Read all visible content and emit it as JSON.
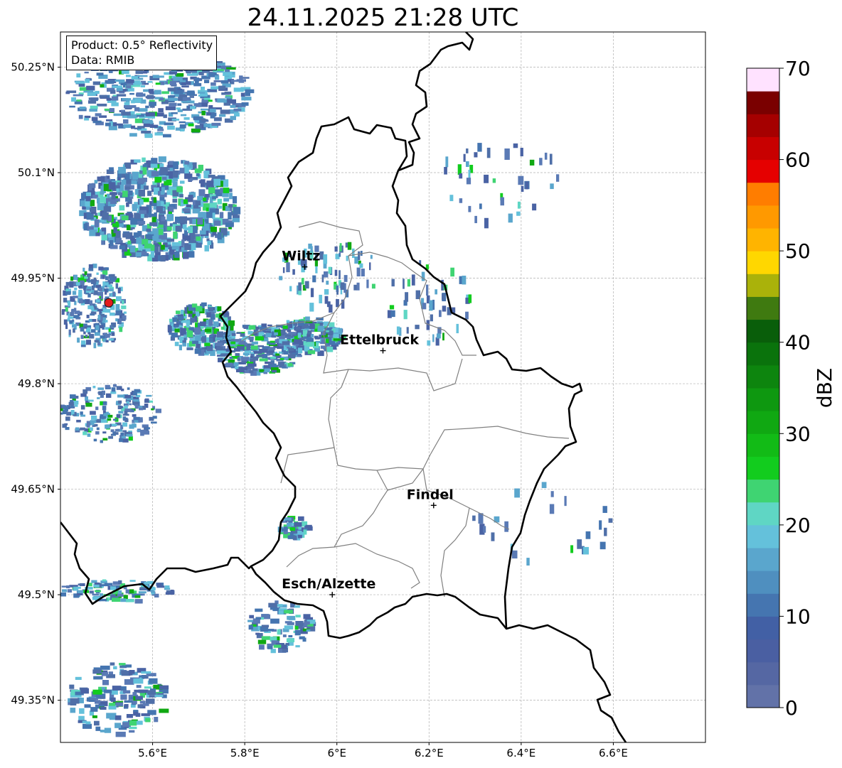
{
  "title": "24.11.2025 21:28 UTC",
  "info": {
    "product": "Product: 0.5° Reflectivity",
    "source": "Data: RMIB"
  },
  "map": {
    "extent": {
      "lon_min": 5.4,
      "lon_max": 6.8,
      "lat_min": 49.29,
      "lat_max": 50.3
    },
    "lon_ticks": [
      {
        "value": 5.6,
        "label": "5.6°E"
      },
      {
        "value": 5.8,
        "label": "5.8°E"
      },
      {
        "value": 6.0,
        "label": "6°E"
      },
      {
        "value": 6.2,
        "label": "6.2°E"
      },
      {
        "value": 6.4,
        "label": "6.4°E"
      },
      {
        "value": 6.6,
        "label": "6.6°E"
      }
    ],
    "lat_ticks": [
      {
        "value": 50.25,
        "label": "50.25°N"
      },
      {
        "value": 50.1,
        "label": "50.1°N"
      },
      {
        "value": 49.95,
        "label": "49.95°N"
      },
      {
        "value": 49.8,
        "label": "49.8°N"
      },
      {
        "value": 49.65,
        "label": "49.65°N"
      },
      {
        "value": 49.5,
        "label": "49.5°N"
      },
      {
        "value": 49.35,
        "label": "49.35°N"
      }
    ],
    "grid": true,
    "radar_site": {
      "lon": 5.505,
      "lat": 49.915
    },
    "cities": [
      {
        "name": "Wiltz",
        "lon": 5.93,
        "lat": 49.966
      },
      {
        "name": "Ettelbruck",
        "lon": 6.1,
        "lat": 49.847
      },
      {
        "name": "Findel",
        "lon": 6.21,
        "lat": 49.627
      },
      {
        "name": "Esch/Alzette",
        "lon": 5.99,
        "lat": 49.5
      }
    ]
  },
  "colorbar": {
    "label": "dBZ",
    "min": 0,
    "max": 70,
    "step": 2.5,
    "ticks": [
      {
        "value": 0,
        "label": "0"
      },
      {
        "value": 10,
        "label": "10"
      },
      {
        "value": 20,
        "label": "20"
      },
      {
        "value": 30,
        "label": "30"
      },
      {
        "value": 40,
        "label": "40"
      },
      {
        "value": 50,
        "label": "50"
      },
      {
        "value": 60,
        "label": "60"
      },
      {
        "value": 70,
        "label": "70"
      }
    ],
    "colors": [
      "#6272a8",
      "#5567a3",
      "#4a5fa2",
      "#4260a5",
      "#4575b0",
      "#4f8fbf",
      "#5aa6cd",
      "#64c1db",
      "#5fd6c4",
      "#3fd472",
      "#12cc1e",
      "#12bb16",
      "#10a812",
      "#0e9810",
      "#0d850e",
      "#0a730c",
      "#095e0a",
      "#3f7a10",
      "#aab20a",
      "#ffd700",
      "#ffb400",
      "#ff9900",
      "#ff7d00",
      "#e50000",
      "#c80000",
      "#a50000",
      "#7a0000",
      "#ffe2ff",
      "#ffb3ff",
      "#ff6ff9",
      "#ec3de8"
    ]
  }
}
